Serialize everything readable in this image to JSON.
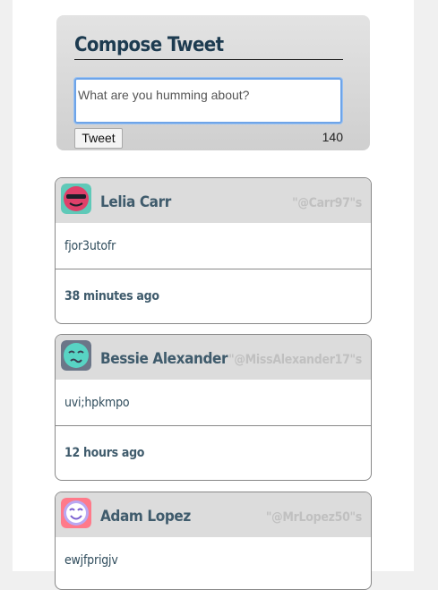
{
  "compose": {
    "title": "Compose Tweet",
    "placeholder": "What are you humming about?",
    "value": "",
    "button_label": "Tweet",
    "char_count": "140"
  },
  "tweets": [
    {
      "name": "Lelia Carr",
      "handle": "\"@Carr97\"s",
      "text": "fjor3utofr",
      "time": "38 minutes ago",
      "avatar_icon": "sunglasses-face-icon",
      "avatar_bg": "#5fc9b8",
      "avatar_fg": "#e0406a"
    },
    {
      "name": "Bessie Alexander",
      "handle": "\"@MissAlexander17\"s",
      "text": "uvi;hpkmpo",
      "time": "12 hours ago",
      "avatar_icon": "sleepy-face-icon",
      "avatar_bg": "#6b7688",
      "avatar_fg": "#58d4c4"
    },
    {
      "name": "Adam Lopez",
      "handle": "\"@MrLopez50\"s",
      "text": "ewjfprigjv",
      "time": "",
      "avatar_icon": "winking-face-icon",
      "avatar_bg": "#ff7a8a",
      "avatar_fg": "#b9a8f2"
    }
  ]
}
